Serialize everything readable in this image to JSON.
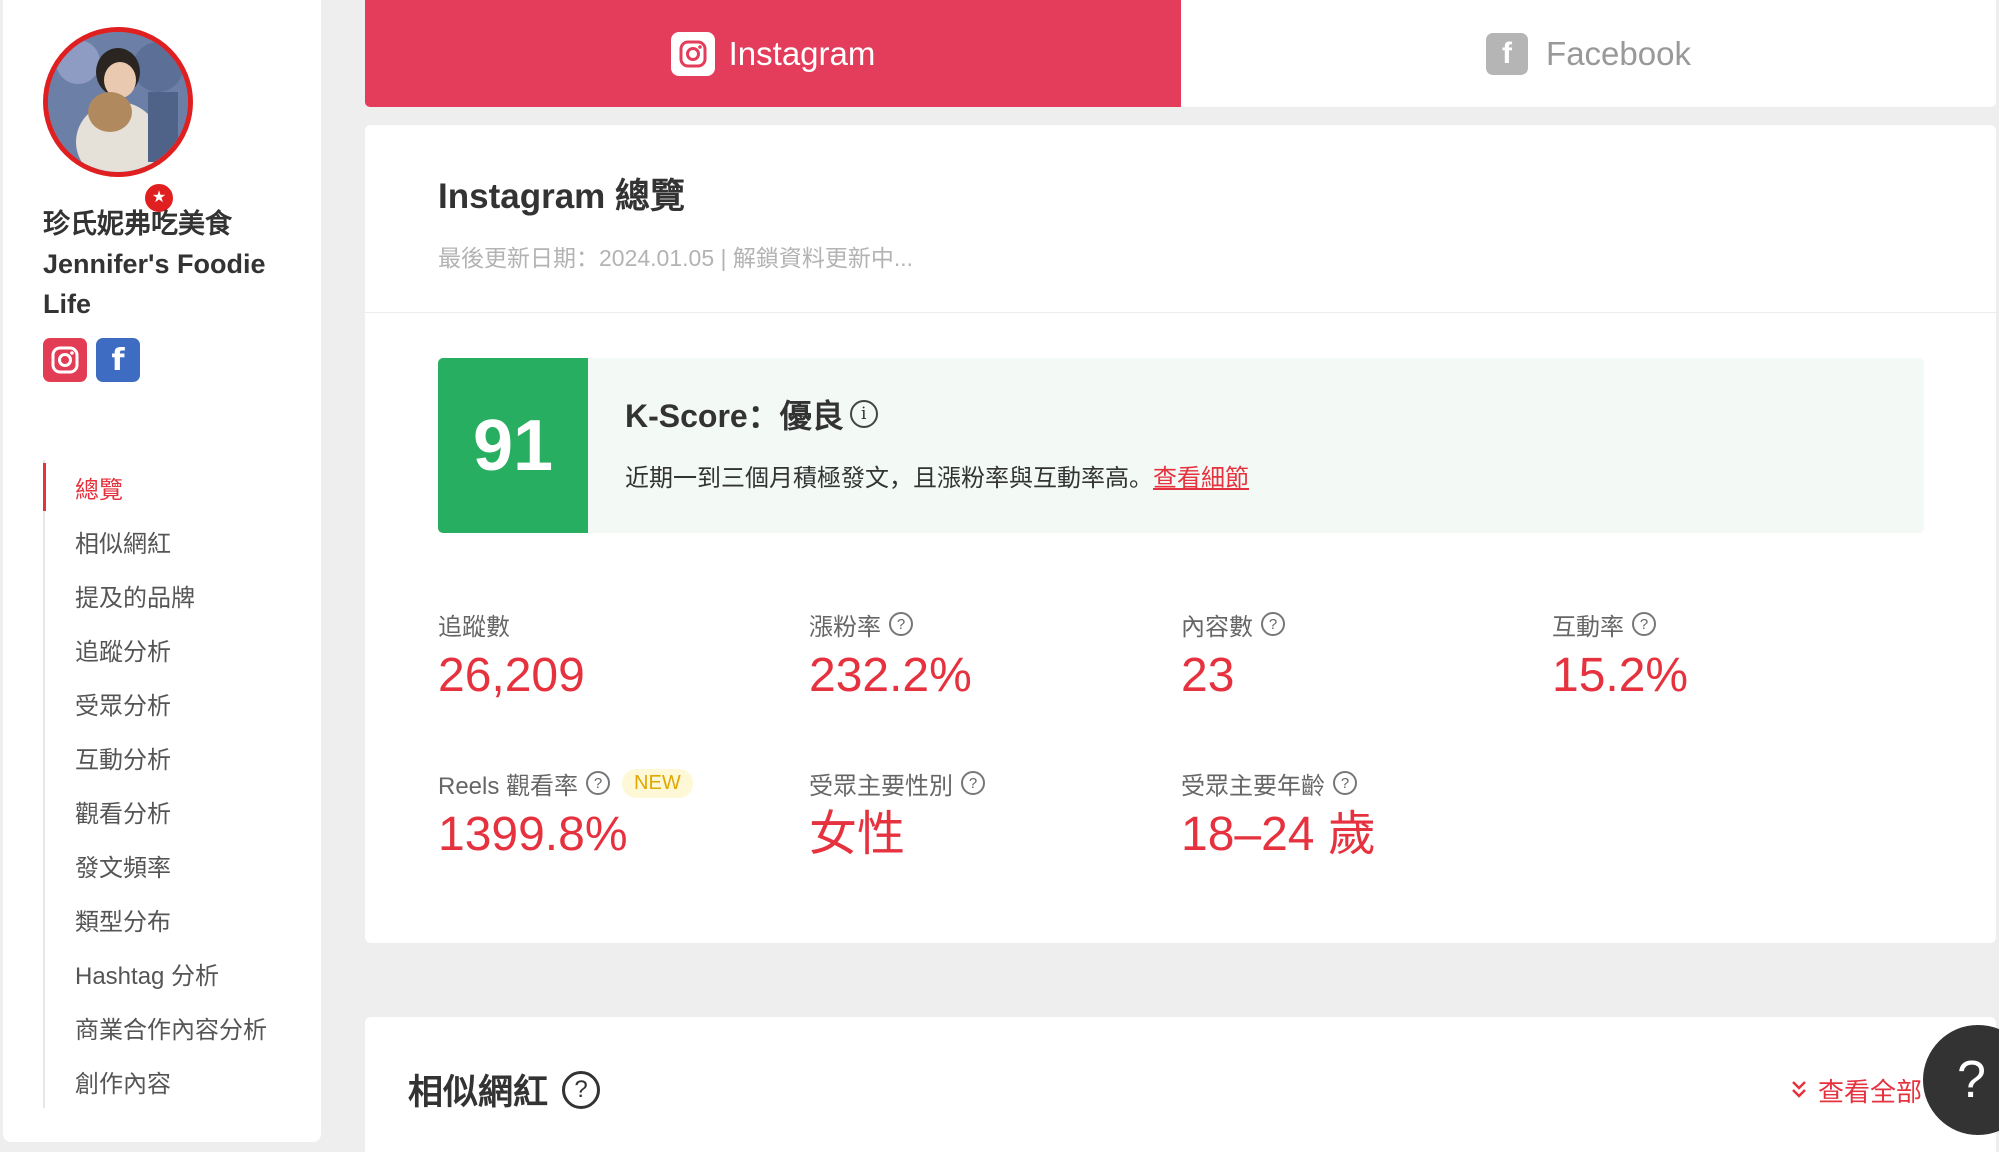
{
  "profile": {
    "name": "珍氏妮弗吃美食 Jennifer's Foodie Life",
    "avatar_badge": "★"
  },
  "sidebar": {
    "items": [
      {
        "label": "總覽",
        "active": true
      },
      {
        "label": "相似網紅"
      },
      {
        "label": "提及的品牌"
      },
      {
        "label": "追蹤分析"
      },
      {
        "label": "受眾分析"
      },
      {
        "label": "互動分析"
      },
      {
        "label": "觀看分析"
      },
      {
        "label": "發文頻率"
      },
      {
        "label": "類型分布"
      },
      {
        "label": "Hashtag 分析"
      },
      {
        "label": "商業合作內容分析"
      },
      {
        "label": "創作內容"
      }
    ]
  },
  "tabs": {
    "instagram": "Instagram",
    "facebook": "Facebook",
    "facebook_icon": "f"
  },
  "overview": {
    "title": "Instagram 總覽",
    "subtitle": "最後更新日期：2024.01.05 | 解鎖資料更新中..."
  },
  "kscore": {
    "value": "91",
    "title": "K-Score：優良",
    "info_icon": "i",
    "description": "近期一到三個月積極發文，且漲粉率與互動率高。",
    "link": "查看細節"
  },
  "metrics": {
    "followers": {
      "label": "追蹤數",
      "value": "26,209"
    },
    "growth": {
      "label": "漲粉率",
      "value": "232.2%"
    },
    "posts": {
      "label": "內容數",
      "value": "23"
    },
    "engagement": {
      "label": "互動率",
      "value": "15.2%"
    },
    "reels": {
      "label": "Reels 觀看率",
      "badge": "NEW",
      "value": "1399.8%"
    },
    "gender": {
      "label": "受眾主要性別",
      "value": "女性"
    },
    "age": {
      "label": "受眾主要年齡",
      "value": "18–24 歲"
    }
  },
  "similar": {
    "title": "相似網紅",
    "view_all": "查看全部"
  },
  "help": {
    "label": "?"
  },
  "colors": {
    "accent": "#e5323e",
    "instagram_tab": "#e33d5b",
    "kscore_green": "#27ae60",
    "facebook_blue": "#3e6cc3"
  }
}
